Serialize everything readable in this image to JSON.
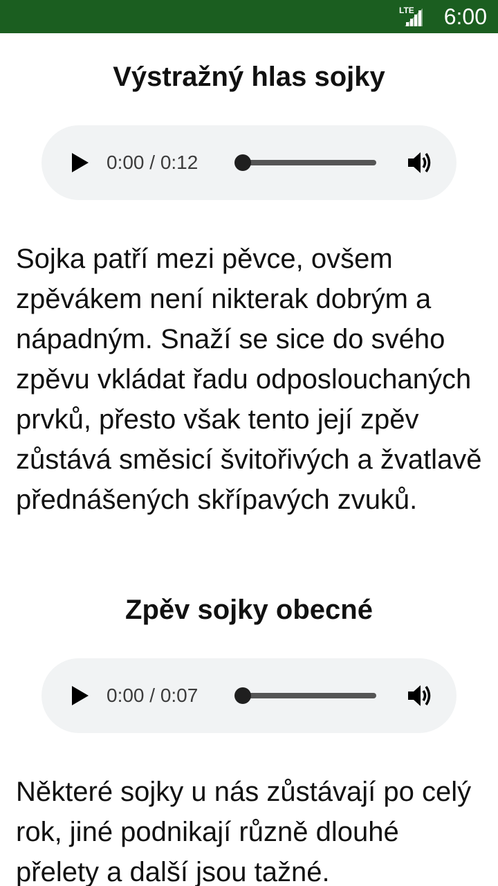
{
  "status_bar": {
    "network": "LTE",
    "time": "6:00",
    "color": "#1b5e20"
  },
  "sections": [
    {
      "title": "Výstražný hlas sojky",
      "player": {
        "time": "0:00 / 0:12",
        "progress": 0
      },
      "paragraph": "Sojka patří mezi pěvce, ovšem zpěvákem není nikterak dobrým a nápadným. Snaží se sice do svého zpěvu vkládat řadu odposlouchaných prvků, přesto však tento její zpěv zůstává směsicí švitořivých a žvatlavě přednášených skřípavých zvuků."
    },
    {
      "title": "Zpěv sojky obecné",
      "player": {
        "time": "0:00 / 0:07",
        "progress": 0
      },
      "paragraph": "Některé sojky u nás zůstávají po celý rok, jiné podnikají různě dlouhé přelety a další jsou tažné."
    }
  ],
  "icons": {
    "signal": "signal-icon",
    "play": "play-icon",
    "volume": "volume-icon"
  }
}
